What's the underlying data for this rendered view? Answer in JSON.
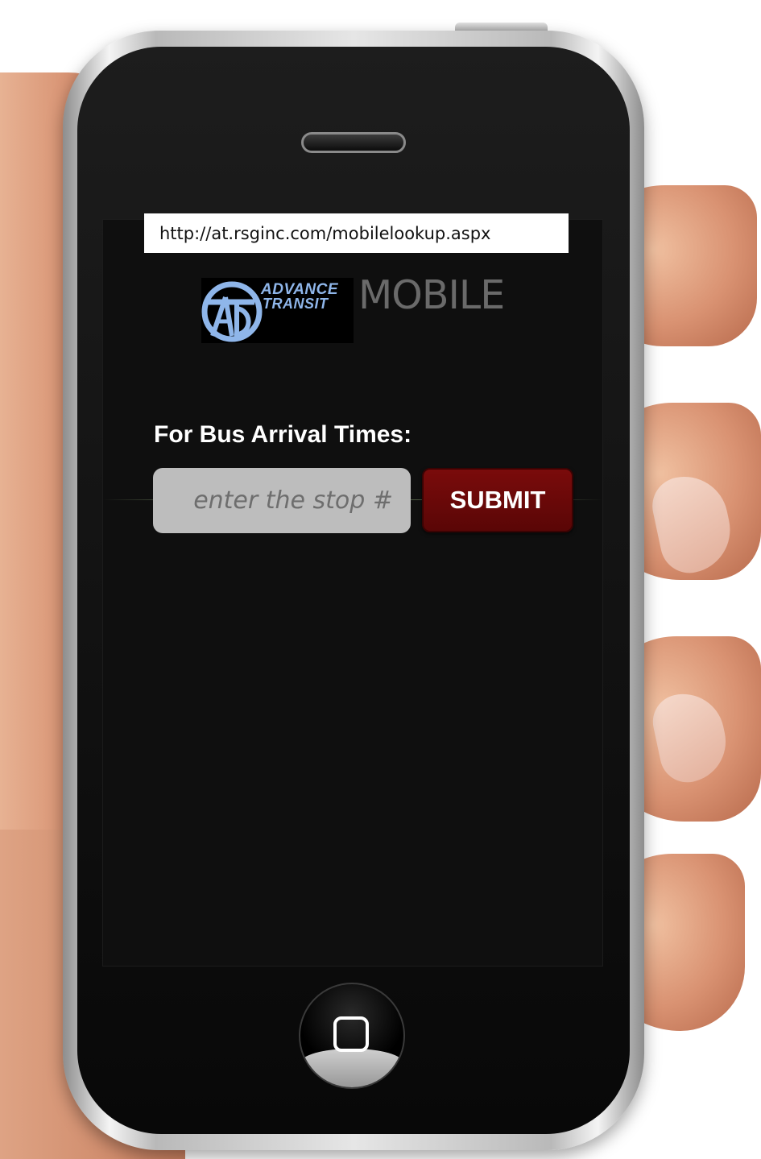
{
  "browser": {
    "url": "http://at.rsginc.com/mobilelookup.aspx"
  },
  "header": {
    "logo_line_1": "ADVANCE",
    "logo_line_2": "TRANSIT",
    "logo_icon": "advance-transit-at-logo-icon",
    "mobile_label": "MOBILE"
  },
  "lookup": {
    "heading": "For Bus Arrival Times:",
    "stop_input_placeholder": "enter the stop #",
    "stop_input_value": "",
    "submit_label": "SUBMIT"
  },
  "device": {
    "home_button_icon": "home-square-icon"
  },
  "colors": {
    "screen_background": "#0f0f0f",
    "submit_button": "#6b0808",
    "input_background": "#bdbdbd",
    "logo_accent": "#8fb6ea",
    "mobile_label": "#6a6a6a"
  }
}
